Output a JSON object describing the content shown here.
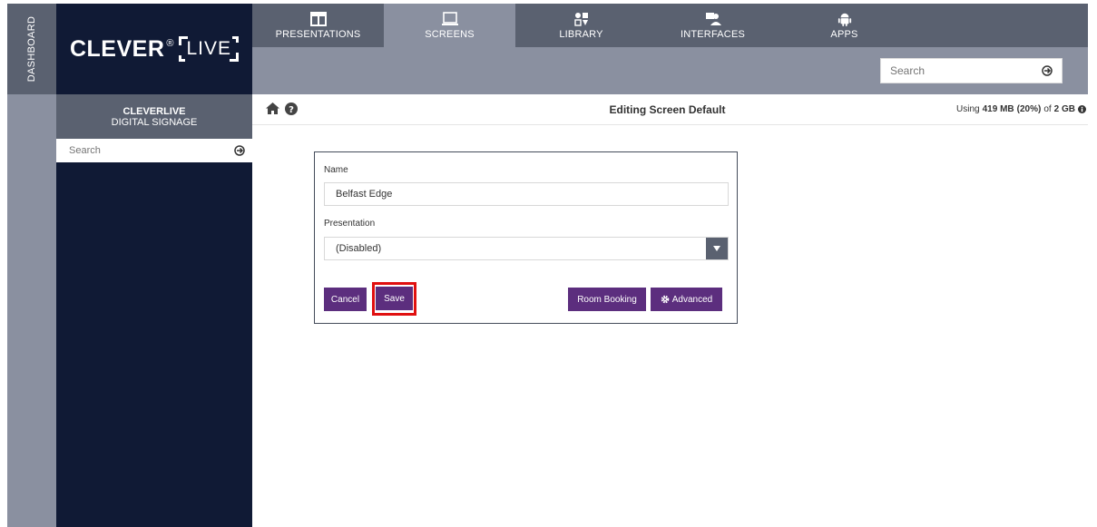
{
  "sidebar_strip": {
    "dashboard_label": "DASHBOARD"
  },
  "logo": {
    "word": "CLEVER",
    "registered": "®",
    "live": "LIVE"
  },
  "nav": {
    "items": [
      {
        "label": "PRESENTATIONS",
        "icon": "presentation-icon"
      },
      {
        "label": "SCREENS",
        "icon": "monitor-icon",
        "active": true
      },
      {
        "label": "LIBRARY",
        "icon": "library-icon"
      },
      {
        "label": "INTERFACES",
        "icon": "interfaces-icon"
      },
      {
        "label": "APPS",
        "icon": "android-icon"
      }
    ],
    "search_placeholder": "Search"
  },
  "left_panel": {
    "title": "CLEVERLIVE",
    "subtitle": "DIGITAL SIGNAGE",
    "search_placeholder": "Search"
  },
  "main": {
    "title": "Editing Screen Default",
    "usage": {
      "prefix": "Using",
      "used": "419 MB",
      "percent": "(20%)",
      "of": "of",
      "total": "2 GB"
    }
  },
  "form": {
    "name_label": "Name",
    "name_value": "Belfast Edge",
    "presentation_label": "Presentation",
    "presentation_value": "(Disabled)",
    "buttons": {
      "cancel": "Cancel",
      "save": "Save",
      "room_booking": "Room Booking",
      "advanced": "Advanced"
    }
  },
  "colors": {
    "nav_dark": "#5a6170",
    "nav_light": "#8a90a0",
    "panel_navy": "#101a35",
    "button_purple": "#5c2e7e",
    "highlight_red": "#e01010"
  }
}
